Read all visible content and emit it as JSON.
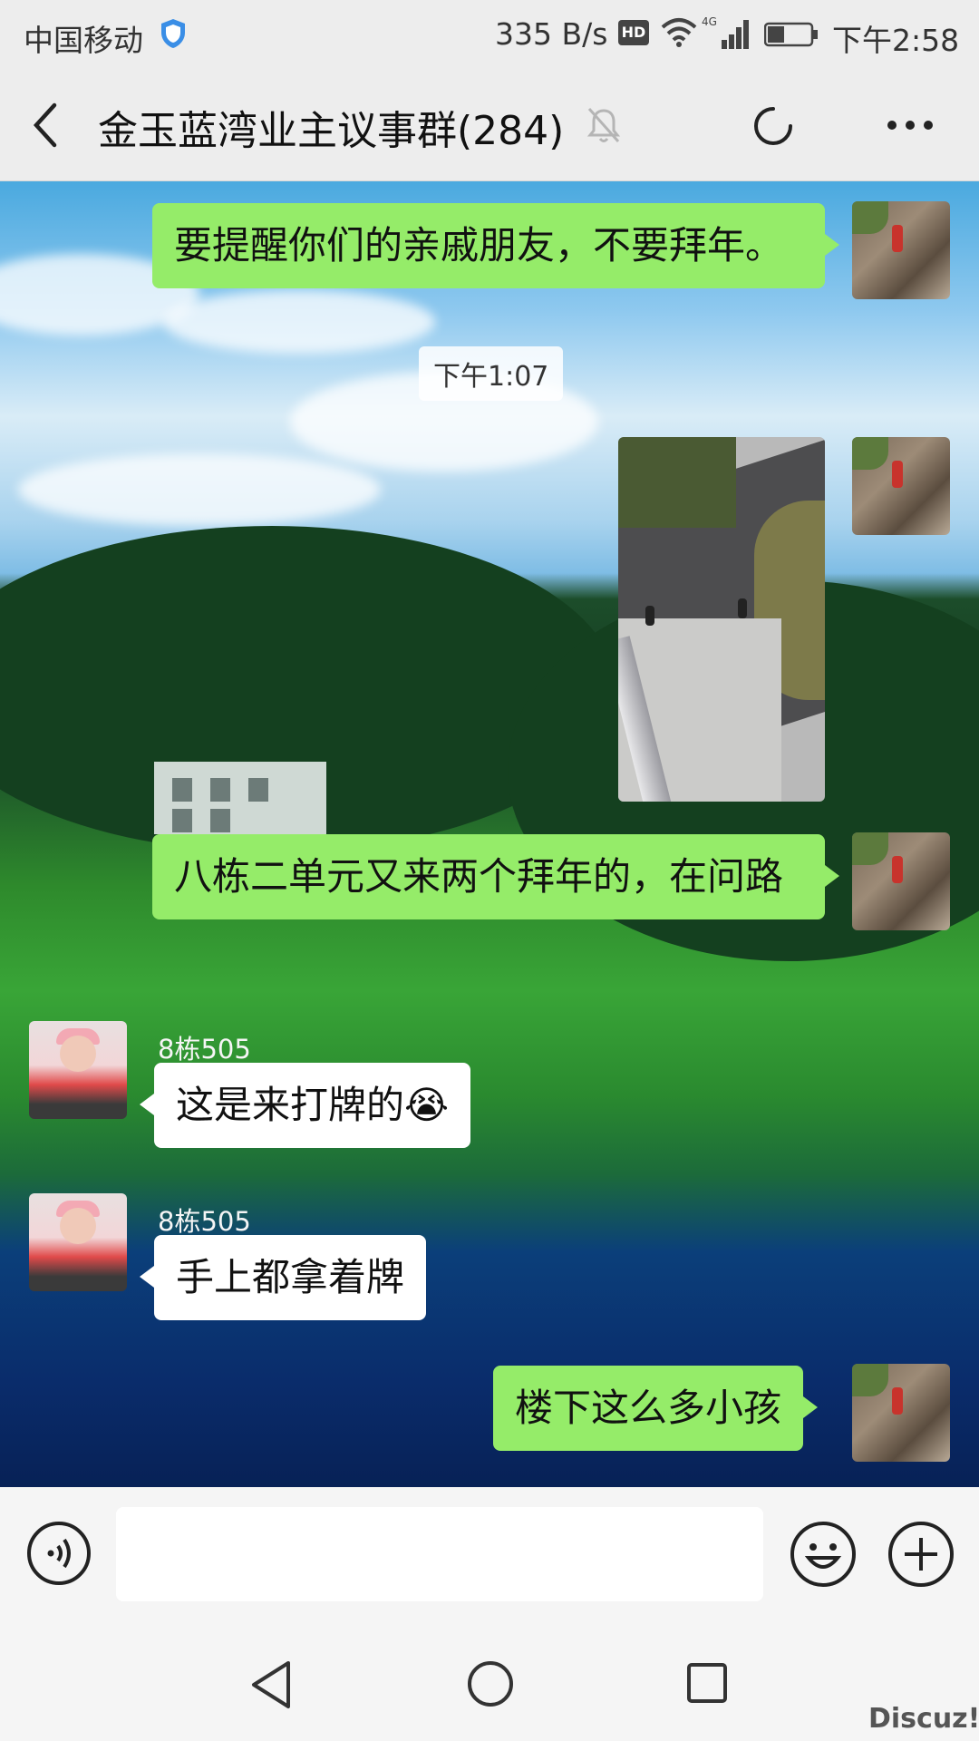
{
  "status_bar": {
    "carrier": "中国移动",
    "net_speed": "335 B/s",
    "hd_badge": "HD",
    "time": "下午2:58"
  },
  "header": {
    "title": "金玉蓝湾业主议事群(284)"
  },
  "chat": {
    "timestamp": "下午1:07",
    "messages": [
      {
        "sender": "me",
        "text": "要提醒你们的亲戚朋友，不要拜年。"
      },
      {
        "sender": "me",
        "type": "image"
      },
      {
        "sender": "me",
        "text": "八栋二单元又来两个拜年的，在问路"
      },
      {
        "sender": "8栋505",
        "nickname": "8栋505",
        "text": "这是来打牌的😭"
      },
      {
        "sender": "8栋505",
        "nickname": "8栋505",
        "text": "手上都拿着牌"
      },
      {
        "sender": "me",
        "text": "楼下这么多小孩"
      }
    ]
  },
  "watermark": "Discuz!",
  "icons": {
    "back": "chevron-left-icon",
    "mute": "bell-muted-icon",
    "refresh": "refresh-icon",
    "more": "more-dots-icon",
    "voice": "voice-icon",
    "emoji": "emoji-icon",
    "plus": "plus-icon"
  },
  "colors": {
    "my_bubble": "#95ec69",
    "other_bubble": "#ffffff",
    "bar_background": "#ededed"
  }
}
